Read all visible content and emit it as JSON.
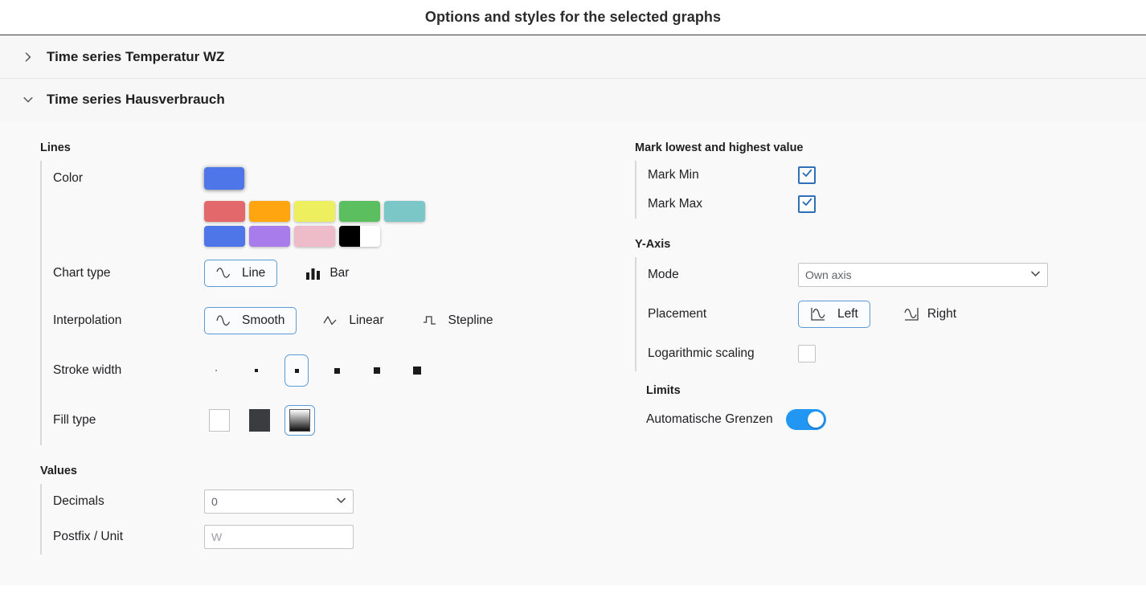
{
  "header": {
    "title": "Options and styles for the selected graphs"
  },
  "accordion": {
    "sections": [
      {
        "title": "Time series Temperatur WZ",
        "icon": "chevron-right-icon",
        "expanded": false
      },
      {
        "title": "Time series Hausverbrauch",
        "icon": "chevron-down-icon",
        "expanded": true
      }
    ]
  },
  "lines": {
    "group_title": "Lines",
    "color": {
      "label": "Color",
      "current": "#4E76E8",
      "palette_row1": [
        "#E2686B",
        "#FFA510",
        "#EEEF5F",
        "#5BBE5F",
        "#7BC6C6"
      ],
      "palette_row2": [
        "#4E76E8",
        "#A97CEC",
        "#EDBCC8"
      ],
      "palette_split": {
        "left": "#000000",
        "right": "#FFFFFF"
      }
    },
    "chart_type": {
      "label": "Chart type",
      "options": [
        {
          "label": "Line",
          "icon": "wave-line-icon",
          "selected": true
        },
        {
          "label": "Bar",
          "icon": "bar-chart-icon",
          "selected": false
        }
      ]
    },
    "interpolation": {
      "label": "Interpolation",
      "options": [
        {
          "label": "Smooth",
          "icon": "wave-smooth-icon",
          "selected": true
        },
        {
          "label": "Linear",
          "icon": "wave-linear-icon",
          "selected": false
        },
        {
          "label": "Stepline",
          "icon": "step-line-icon",
          "selected": false
        }
      ]
    },
    "stroke_width": {
      "label": "Stroke width",
      "options": [
        {
          "size": 2,
          "selected": false
        },
        {
          "size": 4,
          "selected": false
        },
        {
          "size": 5,
          "selected": true
        },
        {
          "size": 7,
          "selected": false
        },
        {
          "size": 8,
          "selected": false
        },
        {
          "size": 10,
          "selected": false
        }
      ]
    },
    "fill_type": {
      "label": "Fill type",
      "options": [
        {
          "name": "none",
          "selected": false
        },
        {
          "name": "solid",
          "selected": false
        },
        {
          "name": "gradient",
          "selected": true
        }
      ]
    }
  },
  "values": {
    "group_title": "Values",
    "decimals": {
      "label": "Decimals",
      "value": "0",
      "icon": "chevron-down-icon"
    },
    "postfix": {
      "label": "Postfix / Unit",
      "value": "",
      "placeholder": "W"
    }
  },
  "mark": {
    "group_title": "Mark lowest and highest value",
    "mark_min": {
      "label": "Mark Min",
      "checked": true,
      "icon": "check-icon"
    },
    "mark_max": {
      "label": "Mark Max",
      "checked": true,
      "icon": "check-icon"
    }
  },
  "yaxis": {
    "group_title": "Y-Axis",
    "mode": {
      "label": "Mode",
      "value": "Own axis",
      "icon": "chevron-down-icon"
    },
    "placement": {
      "label": "Placement",
      "options": [
        {
          "label": "Left",
          "icon": "axis-left-icon",
          "selected": true
        },
        {
          "label": "Right",
          "icon": "axis-right-icon",
          "selected": false
        }
      ]
    },
    "logarithmic": {
      "label": "Logarithmic scaling",
      "checked": false
    }
  },
  "limits": {
    "group_title": "Limits",
    "auto": {
      "label": "Automatische Grenzen",
      "on": true
    }
  },
  "colors": {
    "accent_blue": "#2196f3",
    "selected_border": "#5b9bd5",
    "checkbox_blue": "#2e6fb7",
    "panel_bg": "#f9f9f9",
    "header_bg": "#f7f7f7"
  }
}
